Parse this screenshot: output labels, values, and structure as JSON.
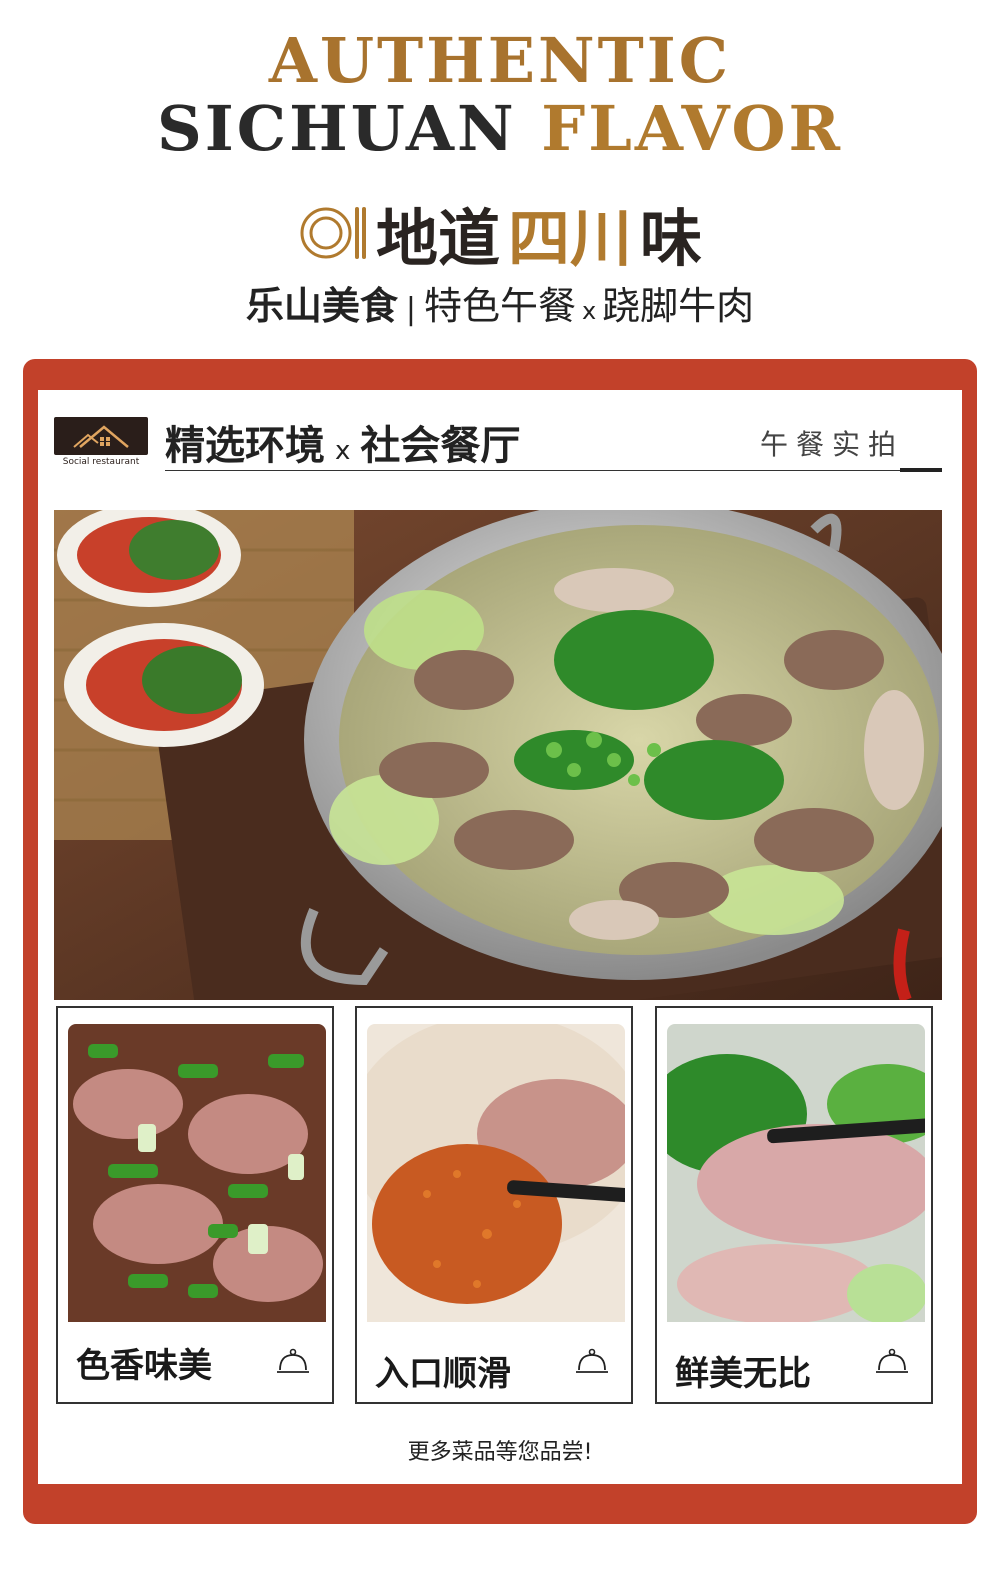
{
  "header": {
    "title_line1": "AUTHENTIC",
    "title_line2_dark": "SICHUAN ",
    "title_line2_gold": "FLAVOR",
    "cn_title_dark": "地道",
    "cn_title_gold": "四川",
    "cn_title_end": "味",
    "subtitle_bold": "乐山美食",
    "subtitle_sep": "|",
    "subtitle_part1": "特色午餐",
    "subtitle_x": "x",
    "subtitle_part2": "跷脚牛肉"
  },
  "section": {
    "logo_caption": "Social restaurant",
    "title_part1": "精选环境",
    "title_x": "x",
    "title_part2": "社会餐厅",
    "right_label": "午餐实拍"
  },
  "dishes": [
    {
      "label": "色香味美",
      "icon": "cloche-icon"
    },
    {
      "label": "入口顺滑",
      "icon": "cloche-icon"
    },
    {
      "label": "鲜美无比",
      "icon": "cloche-icon"
    }
  ],
  "footer": {
    "more_text": "更多菜品等您品尝!"
  },
  "colors": {
    "frame_red": "#c2412a",
    "gold": "#b07a2e",
    "dark": "#2a2421"
  }
}
